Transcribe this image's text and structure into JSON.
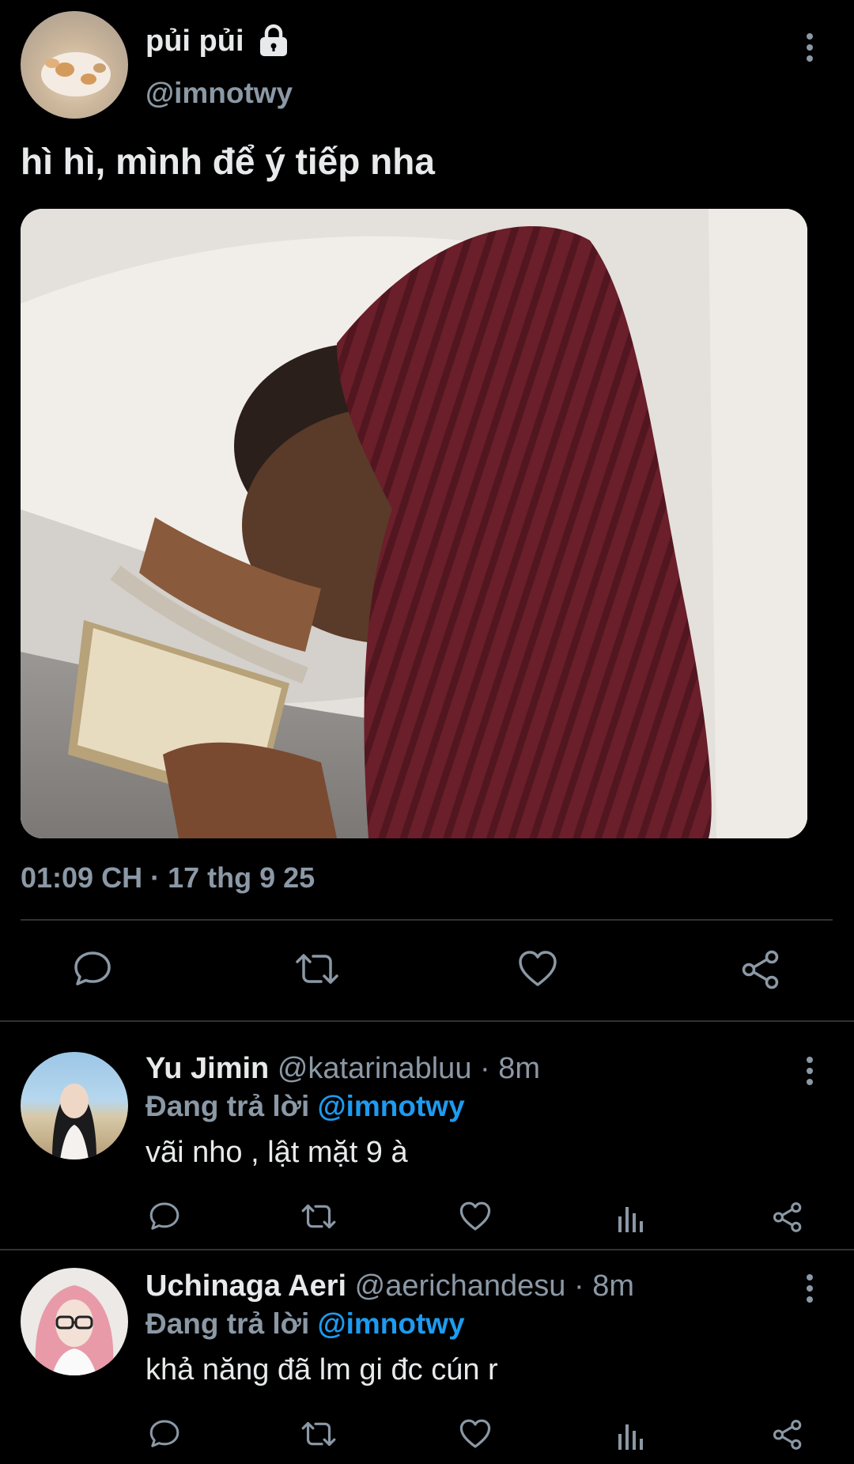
{
  "tweet": {
    "display_name": "pủi pủi",
    "handle": "@imnotwy",
    "text": "hì hì, mình để ý tiếp nha",
    "timestamp": "01:09 CH · 17 thg 9 25"
  },
  "actions": {
    "reply_icon": "reply-icon",
    "retweet_icon": "retweet-icon",
    "like_icon": "heart-icon",
    "share_icon": "share-icon"
  },
  "replies": [
    {
      "display_name": "Yu Jimin",
      "handle": "@katarinabluu",
      "time": "· 8m",
      "replying_label": "Đang trả lời",
      "replying_to": "@imnotwy",
      "text": "vãi nho , lật mặt 9 à"
    },
    {
      "display_name": "Uchinaga Aeri",
      "handle": "@aerichandesu",
      "time": "· 8m",
      "replying_label": "Đang trả lời",
      "replying_to": "@imnotwy",
      "text": "khả năng đã lm gi đc cún r"
    }
  ],
  "colors": {
    "background": "#000000",
    "text": "#e7e9ea",
    "muted": "#8b98a5",
    "link": "#1d9bf0",
    "divider": "#2f3336"
  }
}
